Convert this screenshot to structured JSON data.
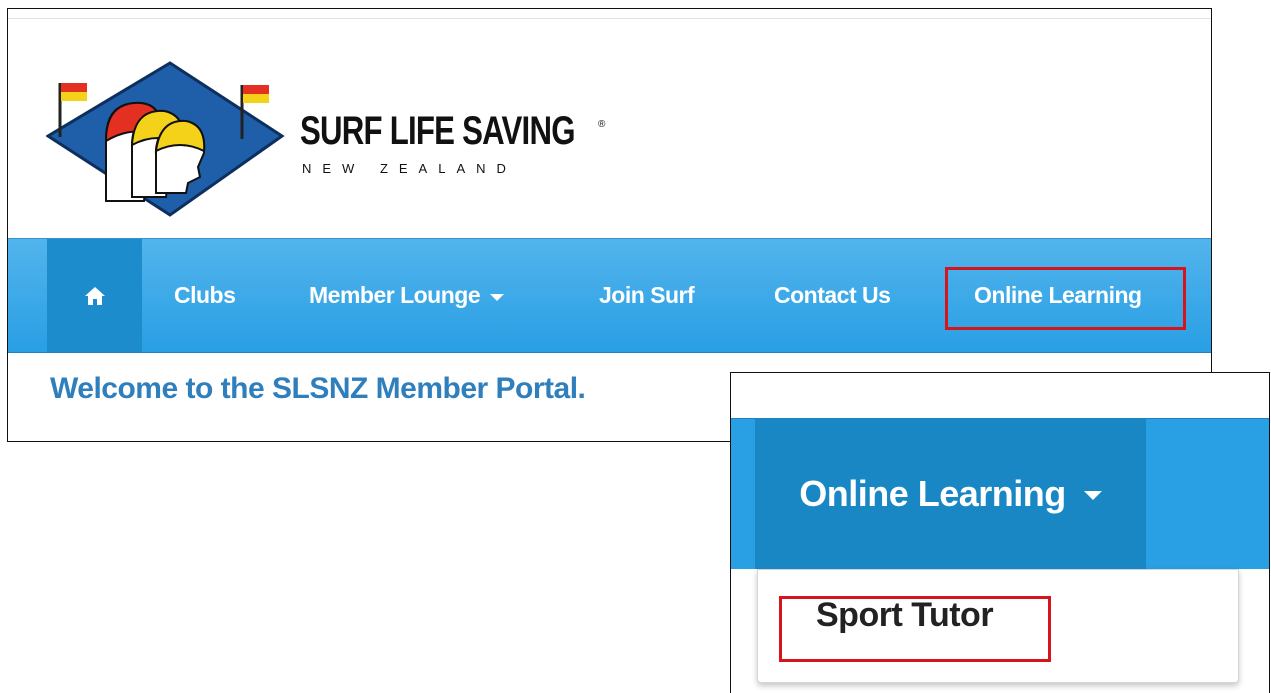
{
  "logo": {
    "title": "SURF LIFE SAVING",
    "registered_mark": "®",
    "subtitle": "NEW ZEALAND"
  },
  "nav": {
    "home_icon": "home-icon",
    "items": [
      {
        "label": "Clubs"
      },
      {
        "label": "Member Lounge"
      },
      {
        "label": "Join Surf"
      },
      {
        "label": "Contact Us"
      },
      {
        "label": "Online Learning"
      }
    ]
  },
  "welcome": "Welcome to the SLSNZ Member Portal.",
  "inset": {
    "menu_label": "Online Learning",
    "dropdown_items": [
      {
        "label": "Sport Tutor"
      }
    ]
  },
  "colors": {
    "nav_blue": "#299fe4",
    "nav_active": "#1a87c5",
    "welcome_text": "#2f7fbd",
    "highlight": "#d5141c"
  }
}
